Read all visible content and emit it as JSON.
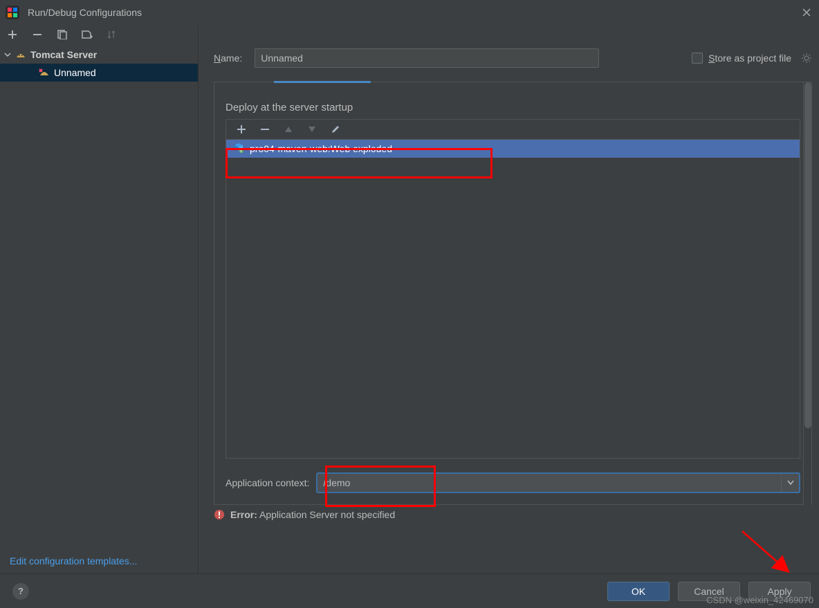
{
  "window": {
    "title": "Run/Debug Configurations"
  },
  "tree": {
    "root": {
      "label": "Tomcat Server"
    },
    "child": {
      "label": "Unnamed"
    }
  },
  "edit_templates": "Edit configuration templates...",
  "form": {
    "name_label": "Name:",
    "name_value": "Unnamed",
    "store_label": "Store as project file"
  },
  "deploy": {
    "section_title": "Deploy at the server startup",
    "item": "pro04-maven-web:Web exploded"
  },
  "app_context": {
    "label": "Application context:",
    "value": "/demo"
  },
  "error": {
    "prefix": "Error:",
    "msg": " Application Server not specified"
  },
  "buttons": {
    "ok": "OK",
    "cancel": "Cancel",
    "apply": "Apply"
  },
  "watermark": "CSDN @weixin_42469070"
}
